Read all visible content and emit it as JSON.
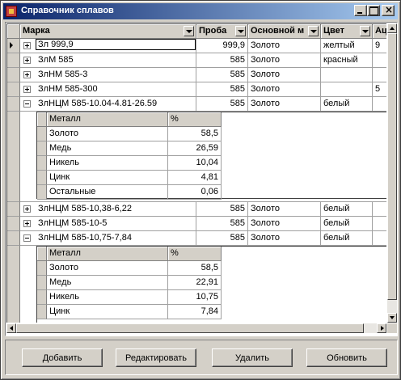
{
  "window": {
    "title": "Справочник сплавов",
    "close_glyph": "×"
  },
  "columns": [
    "Марка",
    "Проба",
    "Основной м",
    "Цвет",
    "Ац"
  ],
  "detail_columns": [
    "Металл",
    "%"
  ],
  "rows": [
    {
      "marka": "Зл 999,9",
      "proba": "999,9",
      "osnovnoy": "Золото",
      "cvet": "желтый",
      "extra": "9"
    },
    {
      "marka": "ЗлМ 585",
      "proba": "585",
      "osnovnoy": "Золото",
      "cvet": "красный",
      "extra": ""
    },
    {
      "marka": "ЗлНМ 585-3",
      "proba": "585",
      "osnovnoy": "Золото",
      "cvet": "",
      "extra": ""
    },
    {
      "marka": "ЗлНМ 585-300",
      "proba": "585",
      "osnovnoy": "Золото",
      "cvet": "",
      "extra": "5"
    },
    {
      "marka": "ЗлНЦМ 585-10.04-4.81-26.59",
      "proba": "585",
      "osnovnoy": "Золото",
      "cvet": "белый",
      "extra": ""
    },
    {
      "marka": "ЗлНЦМ 585-10,38-6,22",
      "proba": "585",
      "osnovnoy": "Золото",
      "cvet": "белый",
      "extra": ""
    },
    {
      "marka": "ЗлНЦМ 585-10-5",
      "proba": "585",
      "osnovnoy": "Золото",
      "cvet": "белый",
      "extra": ""
    },
    {
      "marka": "ЗлНЦМ 585-10,75-7,84",
      "proba": "585",
      "osnovnoy": "Золото",
      "cvet": "белый",
      "extra": ""
    }
  ],
  "detail1": [
    {
      "metal": "Золото",
      "pct": "58,5"
    },
    {
      "metal": "Медь",
      "pct": "26,59"
    },
    {
      "metal": "Никель",
      "pct": "10,04"
    },
    {
      "metal": "Цинк",
      "pct": "4,81"
    },
    {
      "metal": "Остальные",
      "pct": "0,06"
    }
  ],
  "detail2": [
    {
      "metal": "Золото",
      "pct": "58,5"
    },
    {
      "metal": "Медь",
      "pct": "22,91"
    },
    {
      "metal": "Никель",
      "pct": "10,75"
    },
    {
      "metal": "Цинк",
      "pct": "7,84"
    }
  ],
  "buttons": {
    "add": "Добавить",
    "edit": "Редактировать",
    "delete": "Удалить",
    "refresh": "Обновить"
  }
}
